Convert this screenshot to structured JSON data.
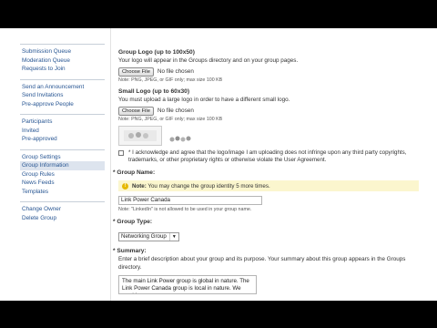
{
  "sidebar": {
    "groups": [
      {
        "items": [
          {
            "label": "Submission Queue"
          },
          {
            "label": "Moderation Queue"
          },
          {
            "label": "Requests to Join"
          }
        ]
      },
      {
        "items": [
          {
            "label": "Send an Announcement"
          },
          {
            "label": "Send Invitations"
          },
          {
            "label": "Pre-approve People"
          }
        ]
      },
      {
        "items": [
          {
            "label": "Participants"
          },
          {
            "label": "Invited"
          },
          {
            "label": "Pre-approved"
          }
        ]
      },
      {
        "items": [
          {
            "label": "Group Settings"
          },
          {
            "label": "Group Information",
            "active": true
          },
          {
            "label": "Group Rules"
          },
          {
            "label": "News Feeds"
          },
          {
            "label": "Templates"
          }
        ]
      },
      {
        "items": [
          {
            "label": "Change Owner"
          },
          {
            "label": "Delete Group"
          }
        ]
      }
    ]
  },
  "form": {
    "group_logo": {
      "label": "Group Logo (up to 100x50)",
      "help": "Your logo will appear in the Groups directory and on your group pages.",
      "button": "Choose File",
      "file_status": "No file chosen",
      "note": "Note: PNG, JPEG, or GIF only; max size 100 KB"
    },
    "small_logo": {
      "label": "Small Logo (up to 60x30)",
      "help": "You must upload a large logo in order to have a different small logo.",
      "button": "Choose File",
      "file_status": "No file chosen",
      "note": "Note: PNG, JPEG, or GIF only; max size 100 KB"
    },
    "agreement": "* I acknowledge and agree that the logo/image I am uploading does not infringe upon any third party copyrights, trademarks, or other proprietary rights or otherwise violate the User Agreement.",
    "group_name": {
      "label": "* Group Name:",
      "notice_prefix": "Note:",
      "notice_text": "You may change the group identity 5 more times.",
      "value": "Link Power Canada",
      "note": "Note: \"LinkedIn\" is not allowed to be used in your group name."
    },
    "group_type": {
      "label": "* Group Type:",
      "selected": "Networking Group"
    },
    "summary": {
      "label": "* Summary:",
      "help": "Enter a brief description about your group and its purpose. Your summary about this group appears in the Groups directory.",
      "value": "The main Link Power group is global in nature. The Link Power Canada group is local in nature. We would"
    }
  }
}
